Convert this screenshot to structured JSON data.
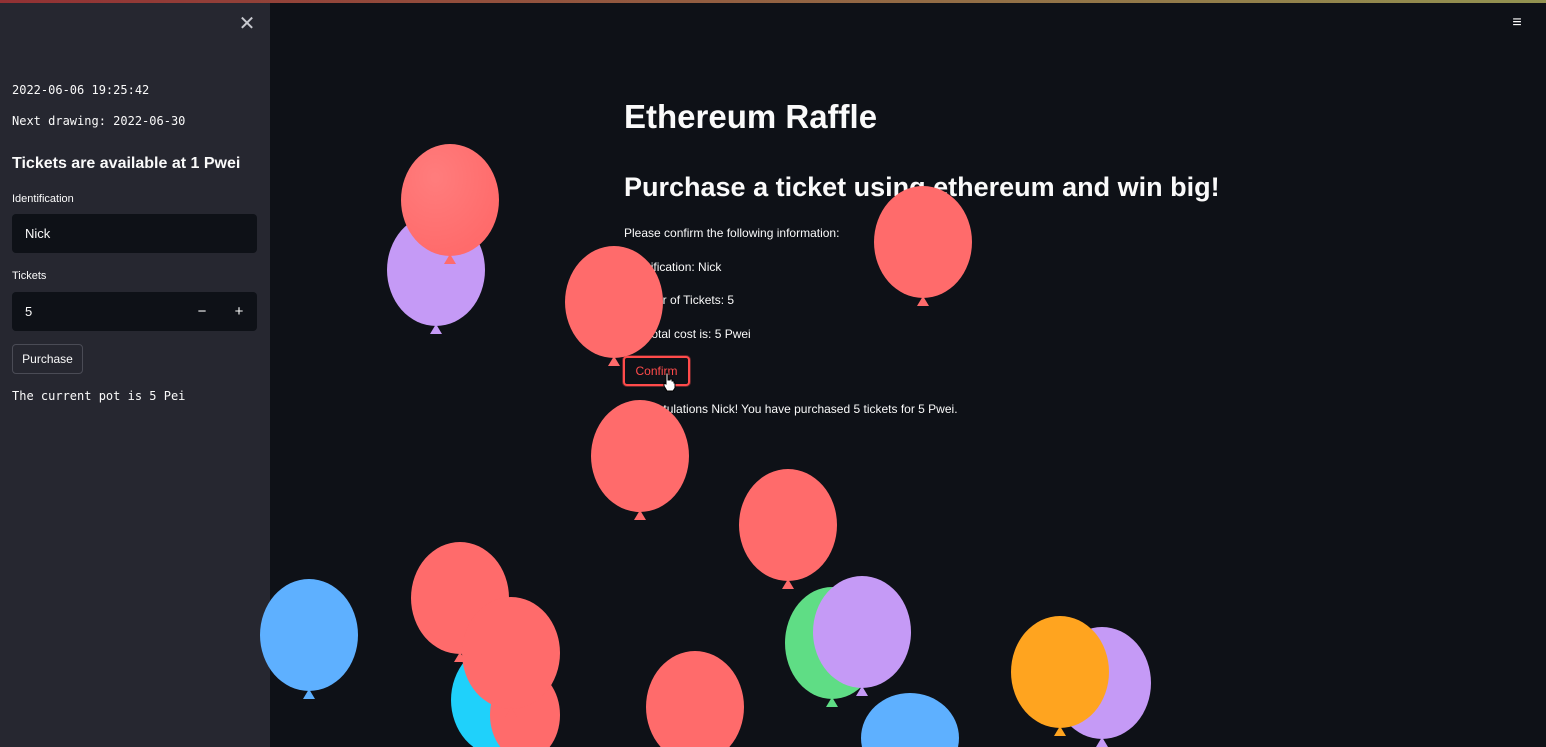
{
  "colors": {
    "background": "#0e1117",
    "sidebar": "#262730",
    "accent": "#ff4b4b",
    "text": "#fafafa",
    "balloon_red": "#ff6b6b",
    "balloon_purple": "#c59af6",
    "balloon_blue": "#5eb0ff",
    "balloon_cyan": "#1fd1fb",
    "balloon_green": "#5fdd85",
    "balloon_orange": "#ffa41f"
  },
  "sidebar": {
    "close_icon": "close-icon",
    "datetime": "2022-06-06 19:25:42",
    "next_drawing": "Next drawing: 2022-06-30",
    "heading": "Tickets are available at 1 Pwei",
    "identification_label": "Identification",
    "identification_value": "Nick",
    "tickets_label": "Tickets",
    "tickets_value": "5",
    "decrement_label": "−",
    "increment_label": "+",
    "purchase_label": "Purchase",
    "pot_text": "The current pot is 5 Pei"
  },
  "header": {
    "menu_icon": "hamburger-menu-icon",
    "menu_glyph": "≡"
  },
  "main": {
    "title": "Ethereum Raffle",
    "subtitle": "Purchase a ticket using ethereum and win big!",
    "confirm_prompt": "Please confirm the following information:",
    "identification_line": "Identification: Nick",
    "tickets_line": "Number of Tickets: 5",
    "cost_line": "The total cost is: 5 Pwei",
    "confirm_label": "Confirm",
    "success_message": "Congratulations Nick! You have purchased 5 tickets for 5 Pwei."
  }
}
